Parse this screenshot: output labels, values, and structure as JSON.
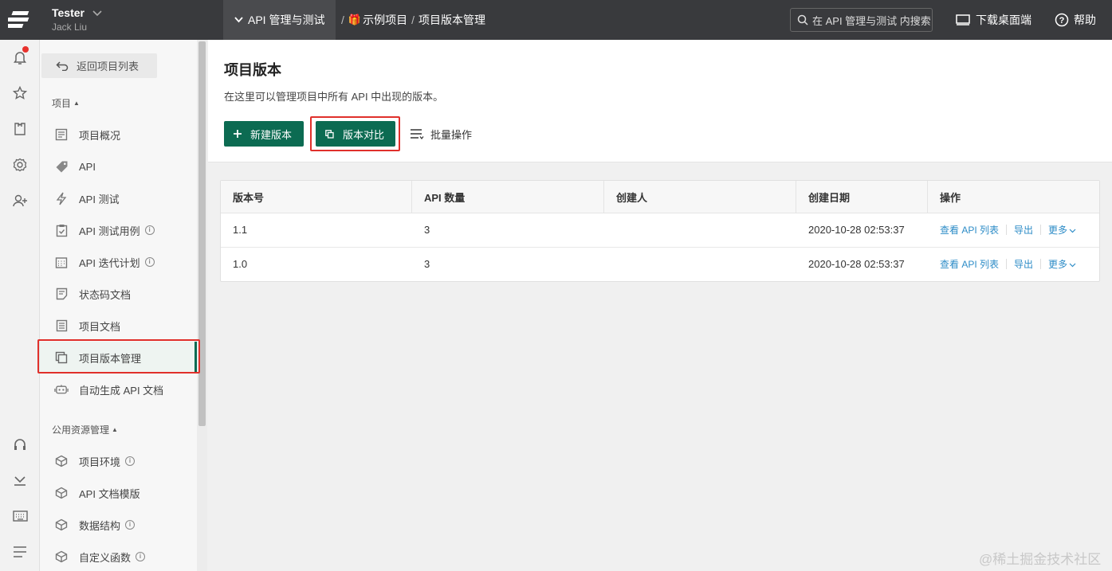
{
  "header": {
    "user_name": "Tester",
    "user_sub": "Jack Liu",
    "module": "API 管理与测试",
    "breadcrumb": [
      "示例项目",
      "项目版本管理"
    ],
    "search_placeholder": "在 API 管理与测试 内搜索",
    "download": "下载桌面端",
    "help": "帮助"
  },
  "rail": {
    "icons": [
      "bell-icon",
      "star-icon",
      "shirt-icon",
      "gear-icon",
      "add-user-icon",
      "headset-icon",
      "download-tray-icon",
      "keyboard-icon",
      "menu-icon"
    ],
    "notification_dot_color": "#e8322d"
  },
  "sidebar": {
    "back": "返回项目列表",
    "section_project": "项目",
    "project_items": [
      {
        "label": "项目概况",
        "icon": "overview-icon",
        "info": false
      },
      {
        "label": "API",
        "icon": "tag-icon",
        "info": false
      },
      {
        "label": "API 测试",
        "icon": "lightning-icon",
        "info": false
      },
      {
        "label": "API 测试用例",
        "icon": "clipboard-check-icon",
        "info": true
      },
      {
        "label": "API 迭代计划",
        "icon": "calendar-icon",
        "info": true
      },
      {
        "label": "状态码文档",
        "icon": "note-icon",
        "info": false
      },
      {
        "label": "项目文档",
        "icon": "document-icon",
        "info": false
      },
      {
        "label": "项目版本管理",
        "icon": "versions-icon",
        "info": false
      },
      {
        "label": "自动生成 API 文档",
        "icon": "robot-icon",
        "info": false
      }
    ],
    "section_public": "公用资源管理",
    "public_items": [
      {
        "label": "项目环境",
        "icon": "cube-icon",
        "info": true
      },
      {
        "label": "API 文档模版",
        "icon": "cube-icon",
        "info": false
      },
      {
        "label": "数据结构",
        "icon": "cube-icon",
        "info": true
      },
      {
        "label": "自定义函数",
        "icon": "cube-icon",
        "info": true
      }
    ],
    "active": "项目版本管理"
  },
  "main": {
    "title": "项目版本",
    "description": "在这里可以管理项目中所有 API 中出现的版本。",
    "new_version": "新建版本",
    "compare_version": "版本对比",
    "batch": "批量操作",
    "accent_color": "#0c6b52",
    "table": {
      "headers": [
        "版本号",
        "API 数量",
        "创建人",
        "创建日期",
        "操作"
      ],
      "rows": [
        {
          "version": "1.1",
          "count": "3",
          "creator": "",
          "date": "2020-10-28 02:53:37"
        },
        {
          "version": "1.0",
          "count": "3",
          "creator": "",
          "date": "2020-10-28 02:53:37"
        }
      ],
      "actions": {
        "view": "查看 API 列表",
        "export": "导出",
        "more": "更多"
      }
    }
  },
  "watermark": "@稀土掘金技术社区"
}
